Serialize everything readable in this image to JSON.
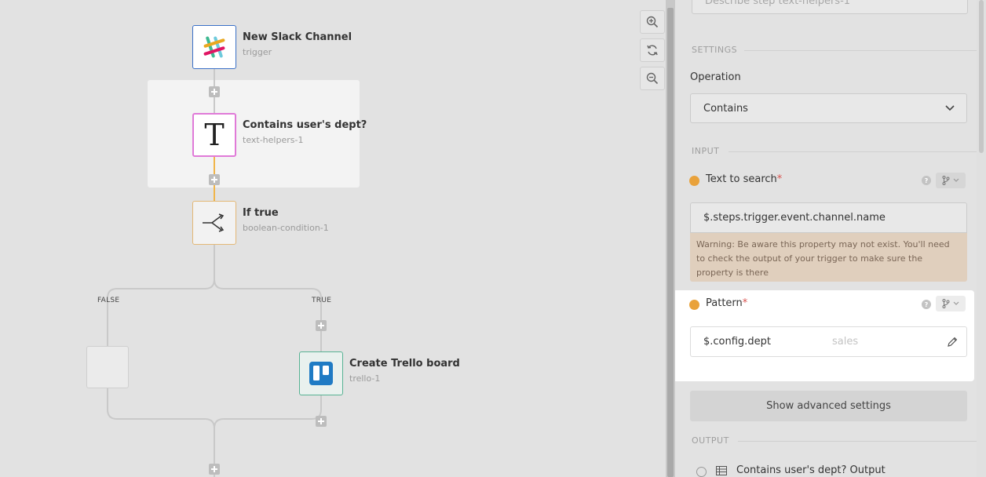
{
  "canvas": {
    "nodes": {
      "trigger": {
        "title": "New Slack Channel",
        "subtitle": "trigger"
      },
      "text_helper": {
        "title": "Contains user's dept?",
        "subtitle": "text-helpers-1",
        "glyph": "T"
      },
      "condition": {
        "title": "If true",
        "subtitle": "boolean-condition-1"
      },
      "trello": {
        "title": "Create Trello board",
        "subtitle": "trello-1"
      }
    },
    "branches": {
      "false_label": "FALSE",
      "true_label": "TRUE"
    },
    "icons": {
      "zoom_in": "zoom-in-icon",
      "refresh": "refresh-icon",
      "zoom_out": "zoom-out-icon",
      "slack": "slack-logo-icon",
      "trello": "trello-logo-icon",
      "branch": "branch-split-icon"
    }
  },
  "panel": {
    "description_placeholder": "Describe step text-helpers-1",
    "settings_label": "SETTINGS",
    "operation": {
      "label": "Operation",
      "value": "Contains"
    },
    "input_label": "INPUT",
    "text_to_search": {
      "label": "Text to search",
      "required_mark": "*",
      "value": "$.steps.trigger.event.channel.name",
      "warning": "Warning: Be aware this property may not exist. You'll need to check the output of your trigger to make sure the property is there"
    },
    "pattern": {
      "label": "Pattern",
      "required_mark": "*",
      "value": "$.config.dept",
      "hint": "sales"
    },
    "advanced_button": "Show advanced settings",
    "output_label": "OUTPUT",
    "output_item": "Contains user's dept? Output",
    "help_glyph": "?"
  },
  "colors": {
    "trigger_border": "#3a70c7",
    "text_helper_border": "#e07ad8",
    "condition_border": "#e3b876",
    "trello_border": "#58b293",
    "connector_active": "#f0b54a",
    "required_dot": "#e9a23b",
    "warning_bg": "#e0cfbd"
  }
}
